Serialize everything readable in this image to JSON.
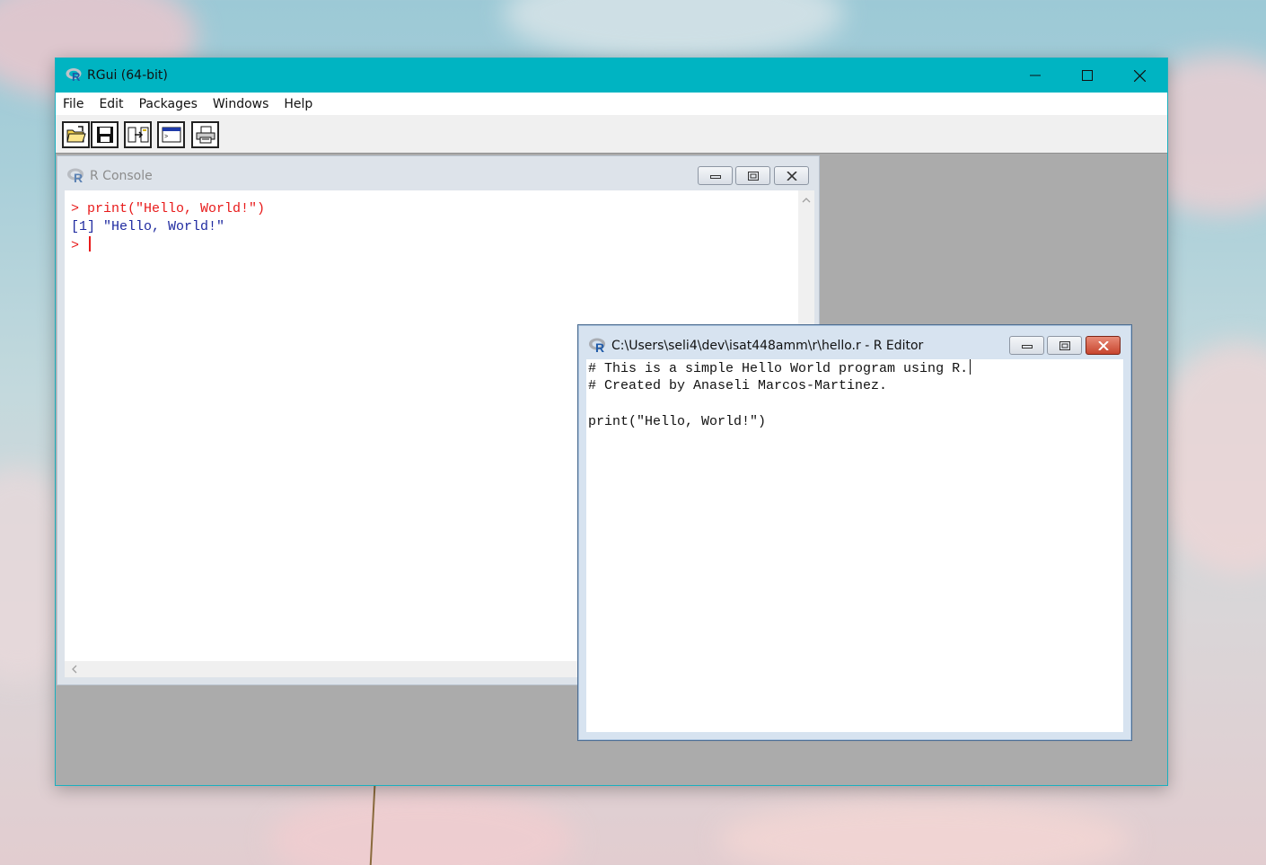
{
  "window": {
    "title": "RGui (64-bit)"
  },
  "menu": [
    "File",
    "Edit",
    "Packages",
    "Windows",
    "Help"
  ],
  "toolbar": {
    "buttons": [
      "open-script-icon",
      "save-icon",
      "paste-commands-icon",
      "console-icon",
      "print-icon"
    ]
  },
  "console": {
    "title": "R Console",
    "lines": [
      {
        "prompt": ">",
        "text": "print(\"Hello, World!\")"
      },
      {
        "text": "[1] \"Hello, World!\""
      },
      {
        "prompt": ">",
        "text": ""
      }
    ]
  },
  "editor": {
    "title": "C:\\Users\\seli4\\dev\\isat448amm\\r\\hello.r - R Editor",
    "lines": [
      "# This is a simple Hello World program using R.",
      "# Created by Anaseli Marcos-Martinez.",
      "",
      "print(\"Hello, World!\")"
    ]
  },
  "colors": {
    "titlebar": "#00b4c2",
    "input_text": "#e81a1a",
    "output_text": "#1f2aa0",
    "mdi_background": "#ababab"
  }
}
